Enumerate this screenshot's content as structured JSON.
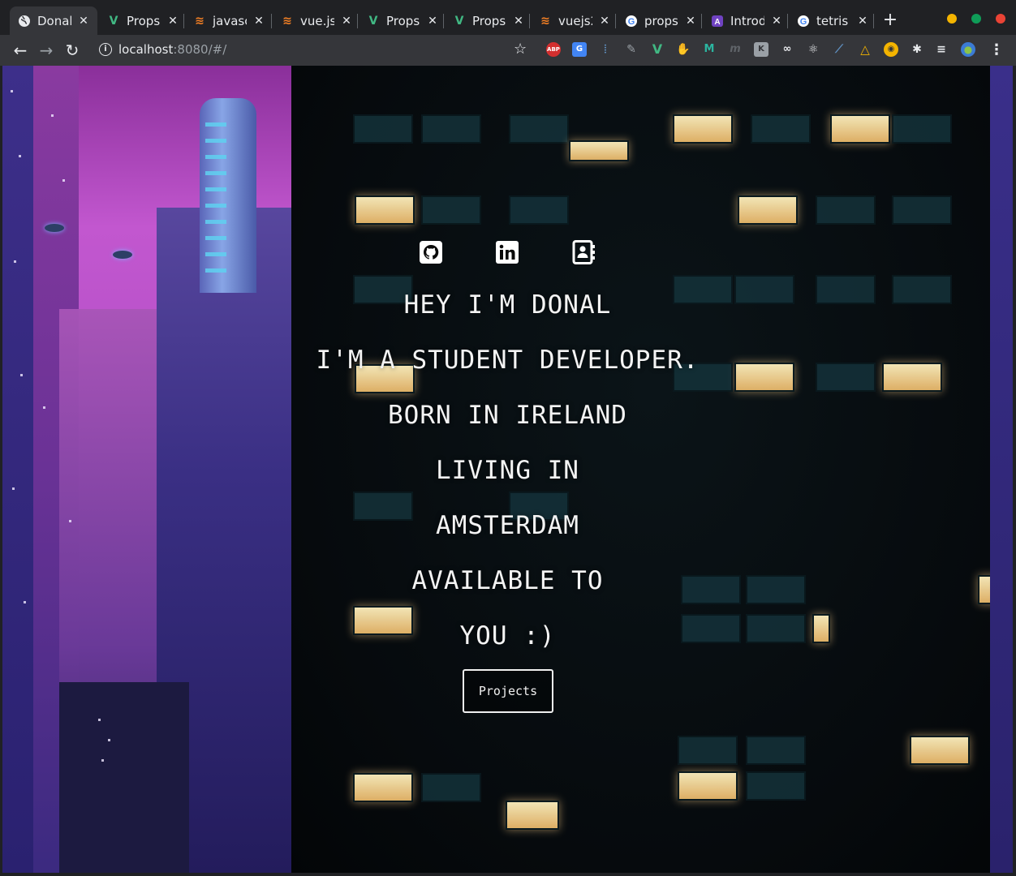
{
  "browser": {
    "tabs": [
      {
        "title": "Donal",
        "icon": "globe-icon",
        "active": true
      },
      {
        "title": "Props",
        "icon": "vue-icon"
      },
      {
        "title": "javasc",
        "icon": "stackoverflow-icon"
      },
      {
        "title": "vue.js",
        "icon": "stackoverflow-icon"
      },
      {
        "title": "Props",
        "icon": "vue-icon"
      },
      {
        "title": "Props",
        "icon": "vue-icon"
      },
      {
        "title": "vuejs2",
        "icon": "stackoverflow-icon"
      },
      {
        "title": "props",
        "icon": "google-icon"
      },
      {
        "title": "Introd",
        "icon": "ant-design-icon"
      },
      {
        "title": "tetris",
        "icon": "google-icon"
      }
    ],
    "new_tab_label": "+",
    "url_host": "localhost",
    "url_rest": ":8080/#/",
    "colors": {
      "tab_bar": "#202124",
      "toolbar": "#35363a",
      "minimize": "#f4b400",
      "maximize": "#0f9d58",
      "close": "#ea4335"
    }
  },
  "page": {
    "social": [
      {
        "name": "github-icon"
      },
      {
        "name": "linkedin-icon"
      },
      {
        "name": "contact-card-icon"
      }
    ],
    "lines": [
      "HEY I'M DONAL",
      "I'M A STUDENT DEVELOPER.",
      "BORN IN IRELAND",
      "LIVING IN",
      "AMSTERDAM",
      "AVAILABLE TO",
      "YOU :)"
    ],
    "projects_label": "Projects"
  }
}
